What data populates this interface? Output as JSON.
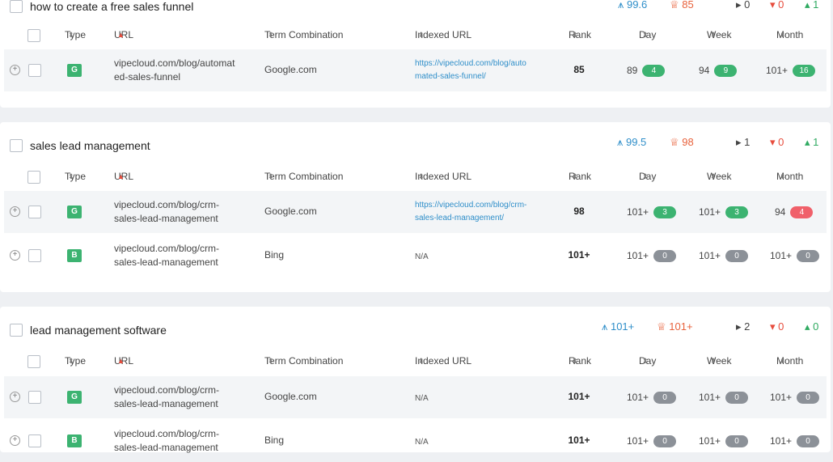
{
  "columns": {
    "type": "Type",
    "url": "URL",
    "term": "Term Combination",
    "indexed": "Indexed URL",
    "rank": "Rank",
    "day": "Day",
    "week": "Week",
    "month": "Month",
    "sort": "⬍",
    "sort_asc": "▲"
  },
  "groups": [
    {
      "keyword": "how to create a free sales funnel",
      "metrics": {
        "visibility": "99.6",
        "trophy": "85",
        "flat": "0",
        "down": "0",
        "up": "1"
      },
      "rows": [
        {
          "type": "G",
          "url": "vipecloud.com/blog/automat ed-sales-funnel",
          "term": "Google.com",
          "indexed": "https://vipecloud.com/blog/auto mated-sales-funnel/",
          "rank": "85",
          "day": "89",
          "day_change": "4",
          "week": "94",
          "week_change": "9",
          "month": "101+",
          "month_change": "16"
        }
      ]
    },
    {
      "keyword": "sales lead management",
      "metrics": {
        "visibility": "99.5",
        "trophy": "98",
        "flat": "1",
        "down": "0",
        "up": "1"
      },
      "rows": [
        {
          "type": "G",
          "url": "vipecloud.com/blog/crm-sales-lead-management",
          "term": "Google.com",
          "indexed": "https://vipecloud.com/blog/crm-sales-lead-management/",
          "rank": "98",
          "day": "101+",
          "day_change": "3",
          "week": "101+",
          "week_change": "3",
          "month": "94",
          "month_change": "4"
        },
        {
          "type": "B",
          "url": "vipecloud.com/blog/crm-sales-lead-management",
          "term": "Bing",
          "indexed": "N/A",
          "rank": "101+",
          "day": "101+",
          "day_change": "0",
          "week": "101+",
          "week_change": "0",
          "month": "101+",
          "month_change": "0"
        }
      ]
    },
    {
      "keyword": "lead management software",
      "metrics": {
        "visibility": "101+",
        "trophy": "101+",
        "flat": "2",
        "down": "0",
        "up": "0"
      },
      "rows": [
        {
          "type": "G",
          "url": "vipecloud.com/blog/crm-sales-lead-management",
          "term": "Google.com",
          "indexed": "N/A",
          "rank": "101+",
          "day": "101+",
          "day_change": "0",
          "week": "101+",
          "week_change": "0",
          "month": "101+",
          "month_change": "0"
        },
        {
          "type": "B",
          "url": "vipecloud.com/blog/crm-sales-lead-management",
          "term": "Bing",
          "indexed": "N/A",
          "rank": "101+",
          "day": "101+",
          "day_change": "0",
          "week": "101+",
          "week_change": "0",
          "month": "101+",
          "month_change": "0"
        }
      ]
    }
  ]
}
